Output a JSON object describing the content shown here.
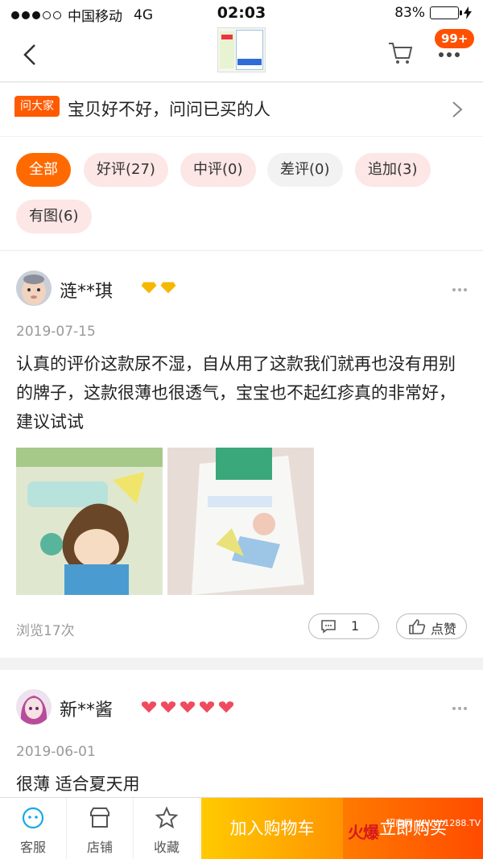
{
  "status_bar": {
    "carrier": "中国移动",
    "network": "4G",
    "time": "02:03",
    "battery": "83%",
    "battery_level": 0.83
  },
  "nav": {
    "badge": "99+"
  },
  "ask": {
    "tag": "问大家",
    "text": "宝贝好不好，问问已买的人"
  },
  "filters": [
    {
      "label": "全部"
    },
    {
      "label": "好评(27)"
    },
    {
      "label": "中评(0)"
    },
    {
      "label": "差评(0)"
    },
    {
      "label": "追加(3)"
    },
    {
      "label": "有图(6)"
    }
  ],
  "reviews": [
    {
      "user": "涟**琪",
      "date": "2019-07-15",
      "content": "认真的评价这款尿不湿，自从用了这款我们就再也没有用别的牌子，这款很薄也很透气，宝宝也不起红疹真的非常好，建议试试",
      "views": "浏览17次",
      "comments": "1",
      "like_label": "点赞",
      "medal_count": 2,
      "medal_color": "#f5b800"
    },
    {
      "user": "新**酱",
      "date": "2019-06-01",
      "content": "很薄 适合夏天用",
      "medal_count": 5,
      "medal_color": "#f04a5e"
    }
  ],
  "bottom": {
    "service": "客服",
    "store": "店铺",
    "favorite": "收藏",
    "add_cart": "加入购物车",
    "buy_now": "立即购买"
  },
  "watermark": {
    "text": "火爆",
    "side": "招商网 WWW.1288.TV"
  },
  "colors": {
    "accent": "#ff5000",
    "chip_active": "#ff6a00",
    "chip_pink": "#fde6e6"
  }
}
